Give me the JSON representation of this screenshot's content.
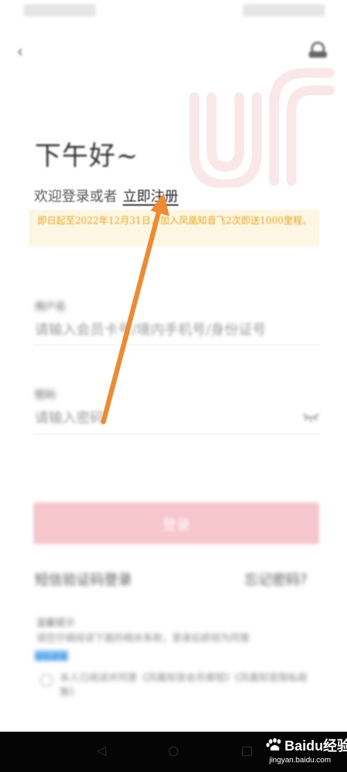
{
  "greeting": "下午好~",
  "welcome": {
    "prefix": "欢迎登录或者",
    "register_label": "立即注册"
  },
  "promo": {
    "text": "即日起至2022年12月31日，加入凤凰知音飞2次即送1000里程。"
  },
  "form": {
    "username_label": "用户名",
    "username_placeholder": "请输入会员卡号/境内手机号/身份证号",
    "password_label": "密码",
    "password_placeholder": "请输入密码"
  },
  "login_button_label": "登录",
  "links": {
    "sms_login": "短信验证码登录",
    "forgot_password": "忘记密码?"
  },
  "notice": {
    "title": "温馨提示",
    "text": "请您仔细阅读下面的相关条款，登录后即视为同意",
    "link": "隐私政策",
    "agree_text": "本人已阅读并同意《凤凰知音会员章程》《凤凰知音隐私政策》"
  },
  "watermark": {
    "brand": "Baidu经验",
    "url": "jingyan.baidu.com"
  },
  "colors": {
    "promo_bg": "#fdf6e2",
    "promo_text": "#e8a81f",
    "login_button": "#f5c6cc",
    "arrow": "#f08a30",
    "logo": "#e35a64"
  },
  "icons": {
    "back": "back-arrow-icon",
    "service": "customer-service-icon",
    "eye": "eye-closed-icon",
    "arrow": "annotation-arrow"
  }
}
